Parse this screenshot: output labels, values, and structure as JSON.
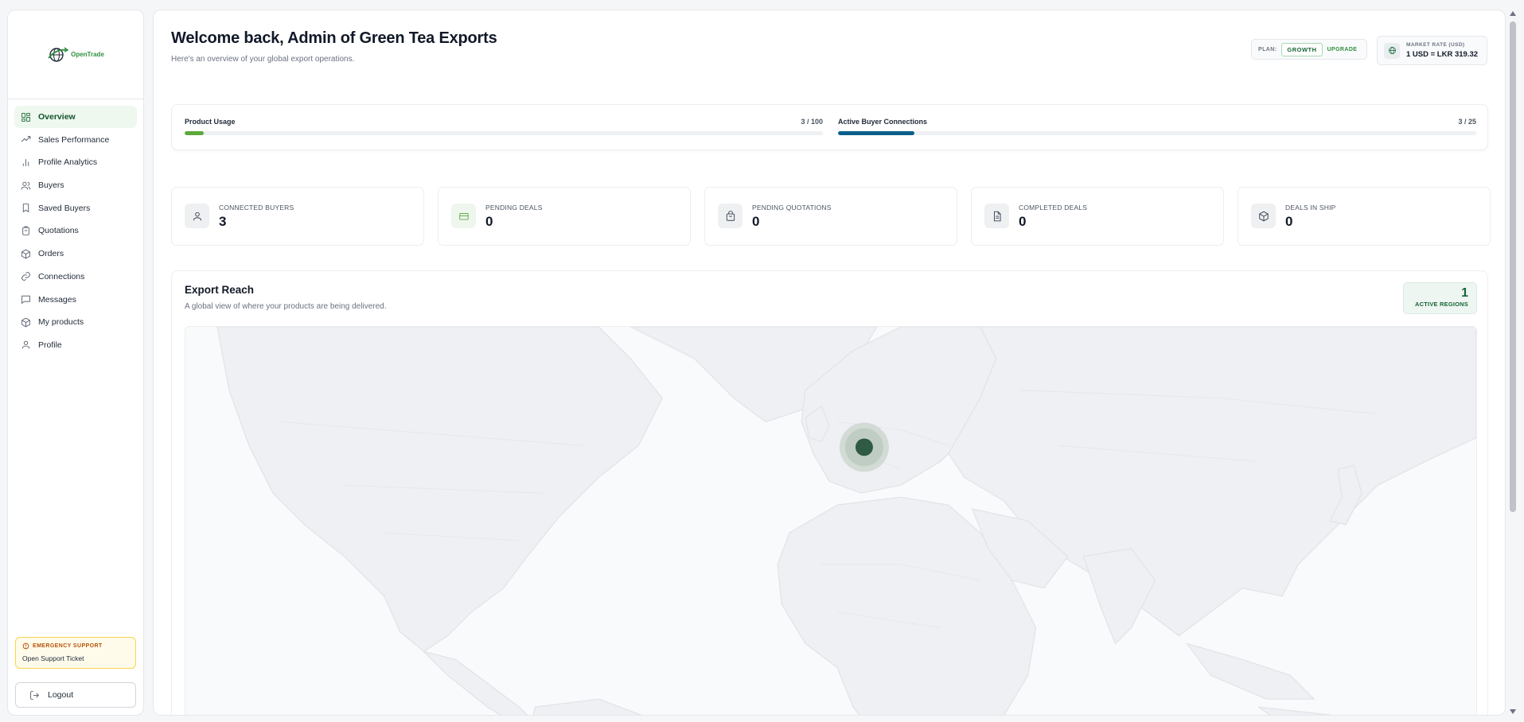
{
  "brand": {
    "name_part1": "Open",
    "name_part2": "Trade"
  },
  "sidebar": {
    "items": [
      {
        "label": "Overview",
        "icon": "grid-icon",
        "active": true
      },
      {
        "label": "Sales Performance",
        "icon": "trending-up-icon"
      },
      {
        "label": "Profile Analytics",
        "icon": "bar-chart-icon"
      },
      {
        "label": "Buyers",
        "icon": "users-icon"
      },
      {
        "label": "Saved Buyers",
        "icon": "bookmark-icon"
      },
      {
        "label": "Quotations",
        "icon": "clipboard-icon"
      },
      {
        "label": "Orders",
        "icon": "package-icon"
      },
      {
        "label": "Connections",
        "icon": "link-icon"
      },
      {
        "label": "Messages",
        "icon": "message-icon"
      },
      {
        "label": "My products",
        "icon": "box-icon"
      },
      {
        "label": "Profile",
        "icon": "user-icon"
      }
    ],
    "emergency": {
      "title": "EMERGENCY SUPPORT",
      "link": "Open Support Ticket"
    },
    "logout": "Logout"
  },
  "header": {
    "title": "Welcome back, Admin of Green Tea Exports",
    "subtitle": "Here's an overview of your global export operations.",
    "plan": {
      "label": "PLAN:",
      "value": "GROWTH",
      "upgrade": "UPGRADE"
    },
    "rate": {
      "label": "MARKET RATE (USD)",
      "value": "1 USD = LKR 319.32"
    }
  },
  "usage": [
    {
      "label": "Product Usage",
      "value": "3 / 100",
      "fraction": 0.03,
      "color": "#5daa3b"
    },
    {
      "label": "Active Buyer Connections",
      "value": "3 / 25",
      "fraction": 0.12,
      "color": "#0b5f8a"
    }
  ],
  "stats": [
    {
      "label": "CONNECTED BUYERS",
      "value": "3",
      "icon": "user-icon"
    },
    {
      "label": "PENDING DEALS",
      "value": "0",
      "icon": "card-icon"
    },
    {
      "label": "PENDING QUOTATIONS",
      "value": "0",
      "icon": "bag-icon"
    },
    {
      "label": "COMPLETED DEALS",
      "value": "0",
      "icon": "document-icon"
    },
    {
      "label": "DEALS IN SHIP",
      "value": "0",
      "icon": "box-icon"
    }
  ],
  "reach": {
    "title": "Export Reach",
    "subtitle": "A global view of where your products are being delivered.",
    "active_regions": "1",
    "active_regions_label": "ACTIVE REGIONS",
    "marker_region": "Europe"
  }
}
